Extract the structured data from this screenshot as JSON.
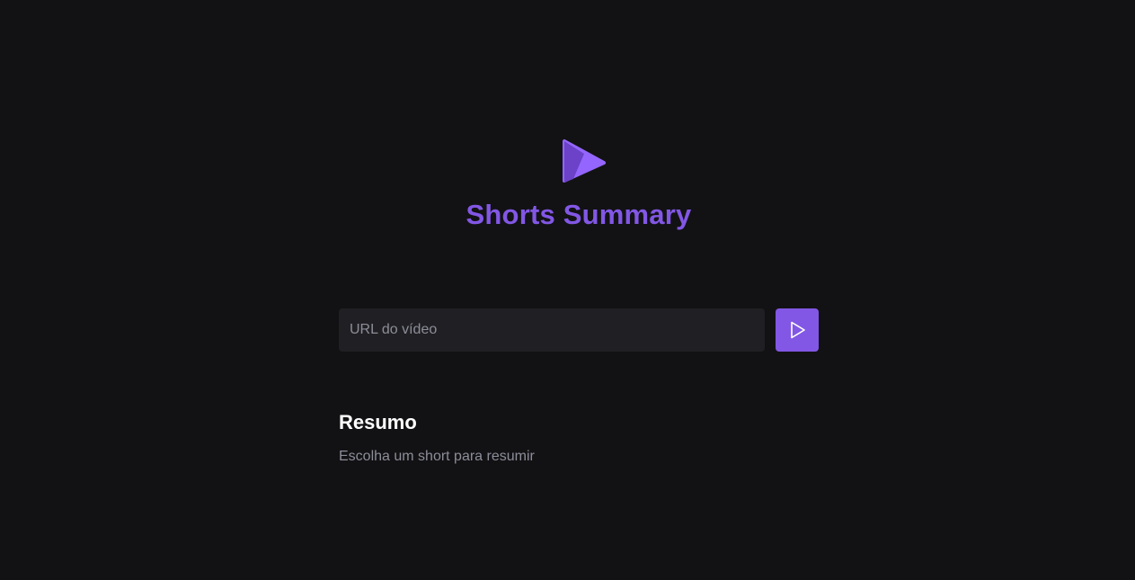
{
  "app": {
    "title": "Shorts Summary",
    "logo_icon": "play-logo-icon"
  },
  "form": {
    "url_placeholder": "URL do vídeo",
    "url_value": "",
    "submit_icon": "play-icon"
  },
  "summary": {
    "heading": "Resumo",
    "text": "Escolha um short para resumir"
  },
  "colors": {
    "background": "#121214",
    "accent": "#8257e5",
    "input_bg": "#202024",
    "muted_text": "#8d8d99",
    "heading_text": "#ffffff"
  }
}
